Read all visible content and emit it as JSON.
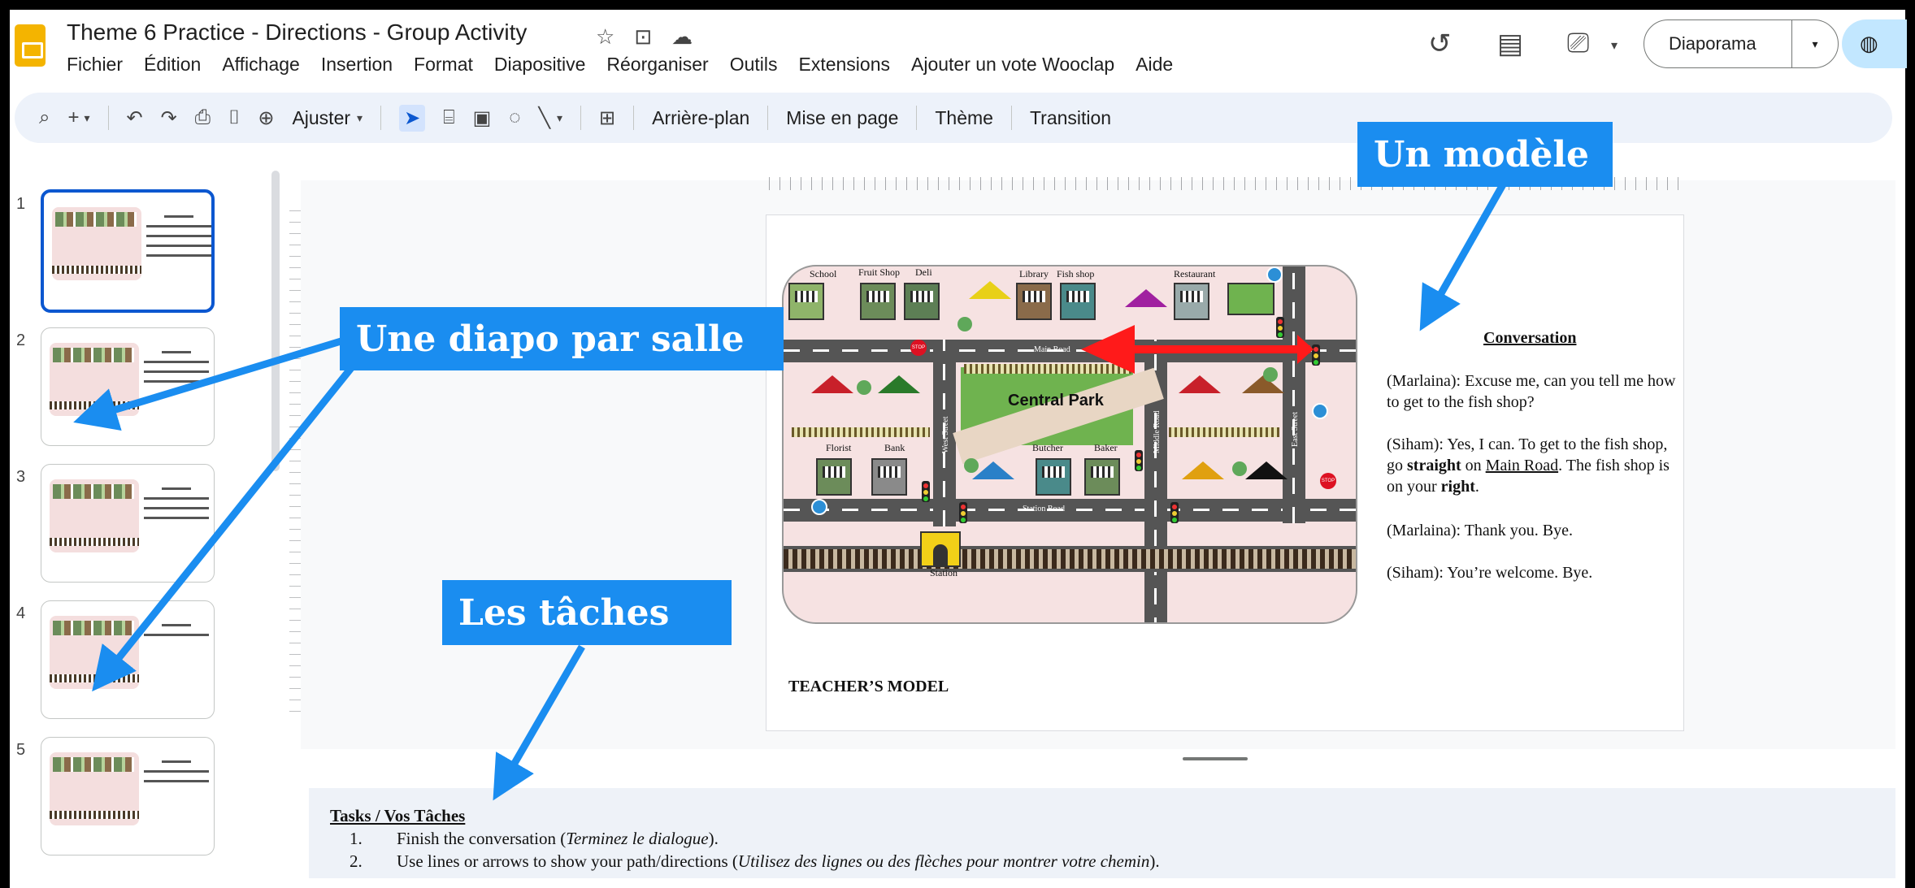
{
  "header": {
    "title": "Theme 6 Practice - Directions - Group Activity",
    "star_icon": "☆",
    "move_icon": "⊡",
    "cloud_icon": "☁",
    "history_icon": "↺",
    "comments_icon": "▤",
    "meet_icon": "⎚",
    "caret": "▾",
    "slideshow_label": "Diaporama",
    "share_icon": "◍"
  },
  "menu": [
    "Fichier",
    "Édition",
    "Affichage",
    "Insertion",
    "Format",
    "Diapositive",
    "Réorganiser",
    "Outils",
    "Extensions",
    "Ajouter un vote Wooclap",
    "Aide"
  ],
  "toolbar": {
    "search": "⌕",
    "new": "+",
    "caret": "▾",
    "undo": "↶",
    "redo": "↷",
    "print": "⎙",
    "paint": "⌷",
    "zoom_icon": "⊕",
    "zoom": "Ajuster",
    "select": "➤",
    "textbox": "⌸",
    "image": "▣",
    "shape": "◌",
    "line": "╲",
    "comment": "⊞",
    "background": "Arrière-plan",
    "layout": "Mise en page",
    "theme": "Thème",
    "transition": "Transition"
  },
  "slides": [
    "1",
    "2",
    "3",
    "4",
    "5"
  ],
  "map": {
    "labels": {
      "school": "School",
      "fruit_shop": "Fruit Shop",
      "deli": "Deli",
      "library": "Library",
      "fish_shop": "Fish shop",
      "restaurant": "Restaurant",
      "main_road": "Main Road",
      "central_park": "Central Park",
      "florist": "Florist",
      "bank": "Bank",
      "butcher": "Butcher",
      "baker": "Baker",
      "west_street": "West Street",
      "middle_road": "Middle Road",
      "east_street": "East Street",
      "station_road": "Station Road",
      "station": "Station",
      "stop": "STOP"
    }
  },
  "conversation": {
    "title": "Conversation",
    "line1": "(Marlaina): Excuse me, can you tell me how to get to the fish shop?",
    "line2_a": "(Siham):  Yes, I can. To get to the fish shop, go ",
    "line2_b": "straight",
    "line2_c": " on ",
    "line2_d": "Main Road",
    "line2_e": ". The fish shop is on your ",
    "line2_f": "right",
    "line2_g": ".",
    "line3": "(Marlaina): Thank you. Bye.",
    "line4": "(Siham): You’re welcome. Bye."
  },
  "teacher_model": "TEACHER’S MODEL",
  "notes": {
    "title": "Tasks / Vos Tâches",
    "items": [
      {
        "num": "1.",
        "text": "Finish the conversation (",
        "italic": "Terminez le dialogue",
        "end": ")."
      },
      {
        "num": "2.",
        "text": "Use lines or arrows to show your path/directions (",
        "italic": "Utilisez des lignes ou des flèches pour montrer votre chemin",
        "end": ")."
      }
    ]
  },
  "callouts": {
    "model": "Un modèle",
    "per_room": "Une diapo par salle",
    "tasks": "Les tâches"
  },
  "colors": {
    "callout": "#1a8df0",
    "route_arrow": "#ff1a1a",
    "selected_thumb": "#0b57d0"
  }
}
